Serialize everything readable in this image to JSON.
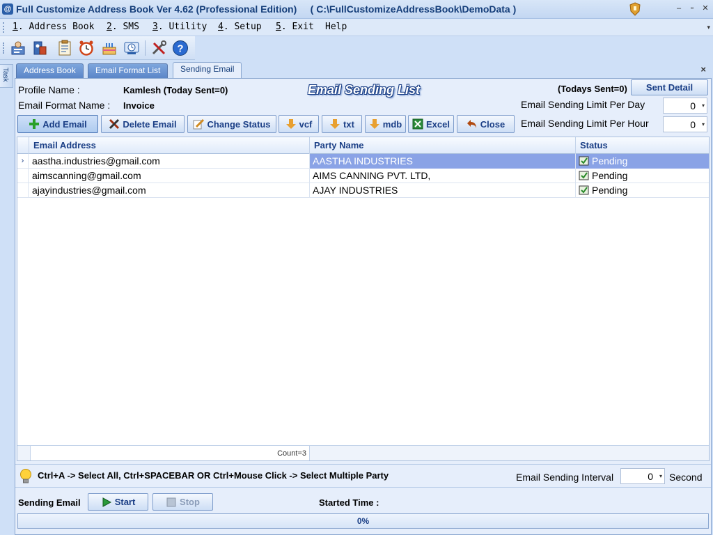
{
  "window": {
    "title": "Full Customize Address Book Ver 4.62 (Professional Edition)     ( C:\\FullCustomizeAddressBook\\DemoData )",
    "minimize": "–",
    "maximize": "▫",
    "close": "✕"
  },
  "menu": {
    "items": [
      {
        "key": "1",
        "label": ". Address Book"
      },
      {
        "key": "2",
        "label": ". SMS"
      },
      {
        "key": "3",
        "label": ". Utility"
      },
      {
        "key": "4",
        "label": ". Setup"
      },
      {
        "key": "5",
        "label": ". Exit"
      },
      {
        "key": "",
        "label": "Help"
      }
    ],
    "chevron": "▾"
  },
  "side": {
    "task_label": "Task"
  },
  "tabs": [
    {
      "label": "Address Book"
    },
    {
      "label": "Email Format List"
    },
    {
      "label": "Sending Email"
    }
  ],
  "tab_close": "×",
  "form": {
    "heading": "Email Sending List",
    "profile_label": "Profile Name :",
    "profile_value": "Kamlesh (Today Sent=0)",
    "format_label": "Email Format Name :",
    "format_value": "Invoice",
    "todays_sent": "(Todays Sent=0)",
    "sent_detail_button": "Sent Detail",
    "limit_day_label": "Email Sending Limit Per Day",
    "limit_day_value": "0",
    "limit_hour_label": "Email Sending Limit Per Hour",
    "limit_hour_value": "0"
  },
  "actions": {
    "add_email": "Add Email",
    "delete_email": "Delete Email",
    "change_status": "Change Status",
    "vcf": "vcf",
    "txt": "txt",
    "mdb": "mdb",
    "excel": "Excel",
    "close": "Close"
  },
  "grid": {
    "columns": [
      "Email Address",
      "Party Name",
      "Status"
    ],
    "rows": [
      {
        "email": "aastha.industries@gmail.com",
        "party": "AASTHA INDUSTRIES",
        "status": "Pending"
      },
      {
        "email": "aimscanning@gmail.com",
        "party": "AIMS CANNING PVT. LTD,",
        "status": "Pending"
      },
      {
        "email": "ajayindustries@gmail.com",
        "party": "AJAY INDUSTRIES",
        "status": "Pending"
      }
    ],
    "row_indicator": "›",
    "count": "Count=3"
  },
  "hint": {
    "text": "Ctrl+A ->  Select All, Ctrl+SPACEBAR  OR  Ctrl+Mouse Click -> Select Multiple Party",
    "interval_label": "Email Sending Interval",
    "interval_value": "0",
    "interval_unit": "Second"
  },
  "sending": {
    "label": "Sending Email",
    "start": "Start",
    "stop": "Stop",
    "started_time_label": "Started Time :",
    "progress_text": "0%",
    "progress_fraction": 0
  }
}
